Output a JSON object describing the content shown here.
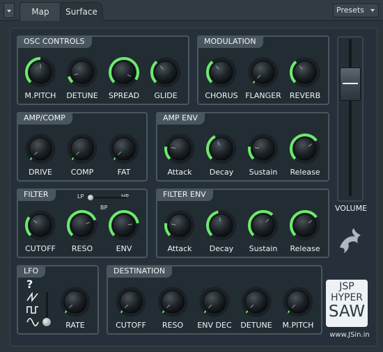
{
  "tabs": [
    {
      "label": "Map"
    },
    {
      "label": "Surface"
    }
  ],
  "presets_label": "Presets",
  "colors": {
    "accent": "#6cea6c",
    "panel_border": "#4a565e",
    "background": "#26303a"
  },
  "panels": {
    "osc": {
      "title": "OSC CONTROLS"
    },
    "mod": {
      "title": "MODULATION"
    },
    "amp": {
      "title": "AMP/COMP"
    },
    "ampenv": {
      "title": "AMP ENV"
    },
    "filter": {
      "title": "FILTER"
    },
    "filterenv": {
      "title": "FILTER ENV"
    },
    "lfo": {
      "title": "LFO"
    },
    "dest": {
      "title": "DESTINATION"
    }
  },
  "knobs": {
    "osc_mpitch": {
      "label": "M.PITCH",
      "value": 0.5
    },
    "osc_detune": {
      "label": "DETUNE",
      "value": 0.1
    },
    "osc_spread": {
      "label": "SPREAD",
      "value": 0.95
    },
    "osc_glide": {
      "label": "GLIDE",
      "value": 0.35
    },
    "mod_chorus": {
      "label": "CHORUS",
      "value": 0.35
    },
    "mod_flanger": {
      "label": "FLANGER",
      "value": 0.0
    },
    "mod_reverb": {
      "label": "REVERB",
      "value": 0.35
    },
    "amp_drive": {
      "label": "DRIVE",
      "value": 0.0
    },
    "amp_comp": {
      "label": "COMP",
      "value": 0.0
    },
    "amp_fat": {
      "label": "FAT",
      "value": 0.0
    },
    "ampenv_attack": {
      "label": "Attack",
      "value": 0.2
    },
    "ampenv_decay": {
      "label": "Decay",
      "value": 0.4
    },
    "ampenv_sustain": {
      "label": "Sustain",
      "value": 0.2
    },
    "ampenv_release": {
      "label": "Release",
      "value": 0.7
    },
    "filter_cutoff": {
      "label": "CUTOFF",
      "value": 0.3
    },
    "filter_reso": {
      "label": "RESO",
      "value": 0.75
    },
    "filter_env": {
      "label": "ENV",
      "value": 0.8
    },
    "filterenv_attack": {
      "label": "Attack",
      "value": 0.2
    },
    "filterenv_decay": {
      "label": "Decay",
      "value": 0.45
    },
    "filterenv_sustain": {
      "label": "Sustain",
      "value": 0.65
    },
    "filterenv_release": {
      "label": "Release",
      "value": 0.7
    },
    "lfo_rate": {
      "label": "RATE",
      "value": 0.0
    },
    "dest_cutoff": {
      "label": "CUTOFF",
      "value": 0.0
    },
    "dest_reso": {
      "label": "RESO",
      "value": 0.0
    },
    "dest_envdec": {
      "label": "ENV DEC",
      "value": 0.0
    },
    "dest_detune": {
      "label": "DETUNE",
      "value": 0.0
    },
    "dest_mpitch": {
      "label": "M.PITCH",
      "value": 0.0
    }
  },
  "filter_switch": {
    "lp": "LP",
    "hp": "HP",
    "bp": "BP",
    "selected": "LP"
  },
  "lfo_shapes": [
    "random-icon",
    "saw-wave-icon",
    "square-wave-icon",
    "sine-wave-icon"
  ],
  "lfo_shape_random_glyph": "?",
  "lfo_shape_selected": "sine-wave-icon",
  "volume": {
    "label": "VOLUME",
    "value": 0.82
  },
  "logo": {
    "line1": "JSP",
    "line2": "HYPER",
    "line3": "SAW",
    "url": "www.JSin.in"
  }
}
